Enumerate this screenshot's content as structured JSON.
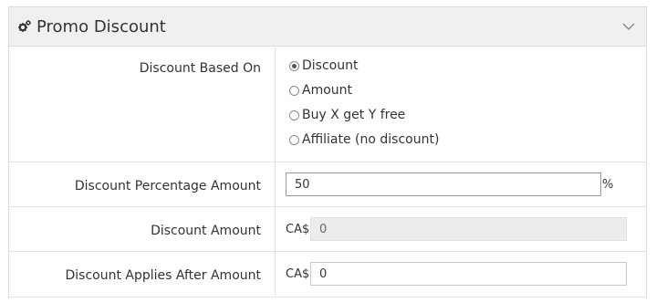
{
  "panel": {
    "title": "Promo Discount",
    "header_icon": "gears-icon",
    "collapse_icon": "chevron-down-icon"
  },
  "discount_based_on": {
    "label": "Discount Based On",
    "options": [
      {
        "label": "Discount",
        "checked": true
      },
      {
        "label": "Amount",
        "checked": false
      },
      {
        "label": "Buy X get Y free",
        "checked": false
      },
      {
        "label": "Affiliate (no discount)",
        "checked": false
      }
    ]
  },
  "discount_percentage": {
    "label": "Discount Percentage Amount",
    "value": "50",
    "suffix": "%"
  },
  "discount_amount": {
    "label": "Discount Amount",
    "prefix": "CA$",
    "value": "0",
    "disabled": true
  },
  "discount_applies_after": {
    "label": "Discount Applies After Amount",
    "prefix": "CA$",
    "value": "0"
  }
}
